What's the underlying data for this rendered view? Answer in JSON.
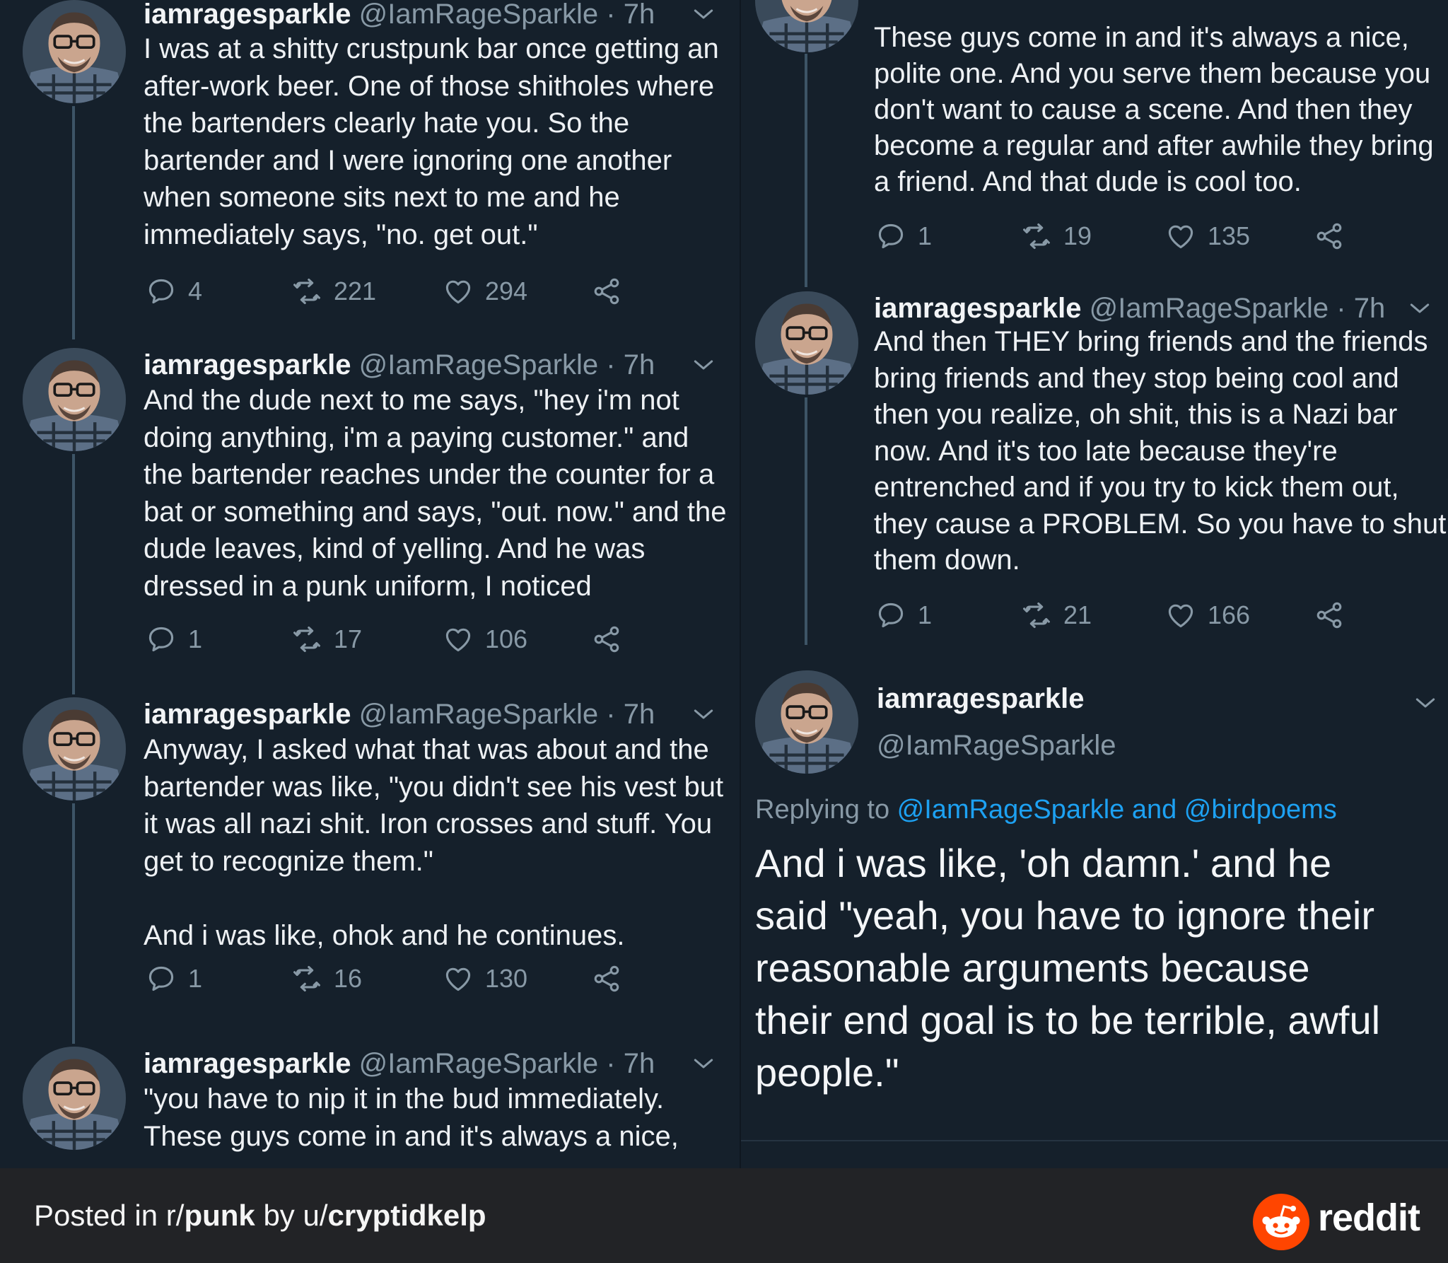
{
  "left_column": {
    "tweets": [
      {
        "name": "iamragesparkle",
        "handle": "@IamRageSparkle · 7h",
        "text": "I was at a shitty crustpunk bar once getting an\nafter-work beer. One of those shitholes where\nthe bartenders clearly hate you. So the\nbartender and I were ignoring one another\nwhen someone sits next to me and he\nimmediately says, \"no. get out.\"",
        "replies": "4",
        "retweets": "221",
        "likes": "294"
      },
      {
        "name": "iamragesparkle",
        "handle": "@IamRageSparkle · 7h",
        "text": "And the dude next to me says, \"hey i'm not\ndoing anything, i'm a paying customer.\" and\nthe bartender reaches under the counter for a\nbat or something and says, \"out. now.\" and the\ndude leaves, kind of yelling. And he was\ndressed in a punk uniform, I noticed",
        "replies": "1",
        "retweets": "17",
        "likes": "106"
      },
      {
        "name": "iamragesparkle",
        "handle": "@IamRageSparkle · 7h",
        "text": "Anyway, I asked what that was about and the\nbartender was like, \"you didn't see his vest but\nit was all nazi shit. Iron crosses and stuff. You\nget to recognize them.\"\n\nAnd i was like, ohok and he continues.",
        "replies": "1",
        "retweets": "16",
        "likes": "130"
      },
      {
        "name": "iamragesparkle",
        "handle": "@IamRageSparkle · 7h",
        "text": "\"you have to nip it in the bud immediately.\nThese guys come in and it's always a nice,"
      }
    ]
  },
  "right_column": {
    "tweets": [
      {
        "text": "These guys come in and it's always a nice,\npolite one. And you serve them because you\ndon't want to cause a scene. And then they\nbecome a regular and after awhile they bring\na friend. And that dude is cool too.",
        "replies": "1",
        "retweets": "19",
        "likes": "135"
      },
      {
        "name": "iamragesparkle",
        "handle": "@IamRageSparkle · 7h",
        "text": "And then THEY bring friends and the friends\nbring friends and they stop being cool and\nthen you realize, oh shit, this is a Nazi bar\nnow. And it's too late because they're\nentrenched and if you try to kick them out,\nthey cause a PROBLEM. So you have to shut\nthem down.",
        "replies": "1",
        "retweets": "21",
        "likes": "166"
      }
    ],
    "main_tweet": {
      "name": "iamragesparkle",
      "handle": "@IamRageSparkle",
      "replying_prefix": "Replying to ",
      "replying_to": "@IamRageSparkle and @birdpoems",
      "text": "And i was like, 'oh damn.' and he\nsaid \"yeah, you have to ignore their\nreasonable arguments because\ntheir end goal is to be terrible, awful\npeople.\""
    }
  },
  "footer": {
    "posted_in": "Posted in r/",
    "subreddit": "punk",
    "by": " by u/",
    "user": "cryptidkelp",
    "brand": "reddit"
  },
  "colors": {
    "background": "#15202b",
    "text": "#e8ecef",
    "muted": "#8899a6",
    "link": "#1da1f2",
    "footer": "#222326",
    "reddit": "#ff4500"
  },
  "icons": [
    "reply-icon",
    "retweet-icon",
    "like-icon",
    "share-icon",
    "chevron-down-icon",
    "reddit-logo"
  ]
}
